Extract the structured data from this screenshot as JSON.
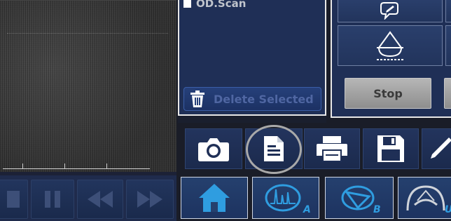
{
  "file_list": {
    "items": [
      {
        "label": "OD.Scan",
        "checked": false
      }
    ],
    "delete_button_label": "Delete Selected",
    "delete_icon": "trash-icon"
  },
  "right_panel": {
    "buttons": [
      {
        "icon": "measure-pen-icon"
      },
      {
        "icon": "drop-shape-icon"
      }
    ],
    "stop_label": "Stop"
  },
  "toolbar": {
    "icons": [
      "camera-icon",
      "report-icon",
      "print-icon",
      "save-icon",
      "pencil-icon"
    ],
    "highlighted": "report-icon"
  },
  "transport": {
    "icons": [
      "stop-icon",
      "pause-icon",
      "rewind-icon",
      "fast-forward-icon"
    ]
  },
  "modes": [
    {
      "icon": "home-icon",
      "letter": ""
    },
    {
      "icon": "a-scan-icon",
      "letter": "A"
    },
    {
      "icon": "b-scan-icon",
      "letter": "B"
    },
    {
      "icon": "ubm-icon",
      "letter": "U"
    }
  ],
  "colors": {
    "panel_bg": "#1f2f56",
    "accent_blue": "#2f9de0",
    "icon_white": "#ffffff",
    "disabled_text": "#4f66a2"
  }
}
